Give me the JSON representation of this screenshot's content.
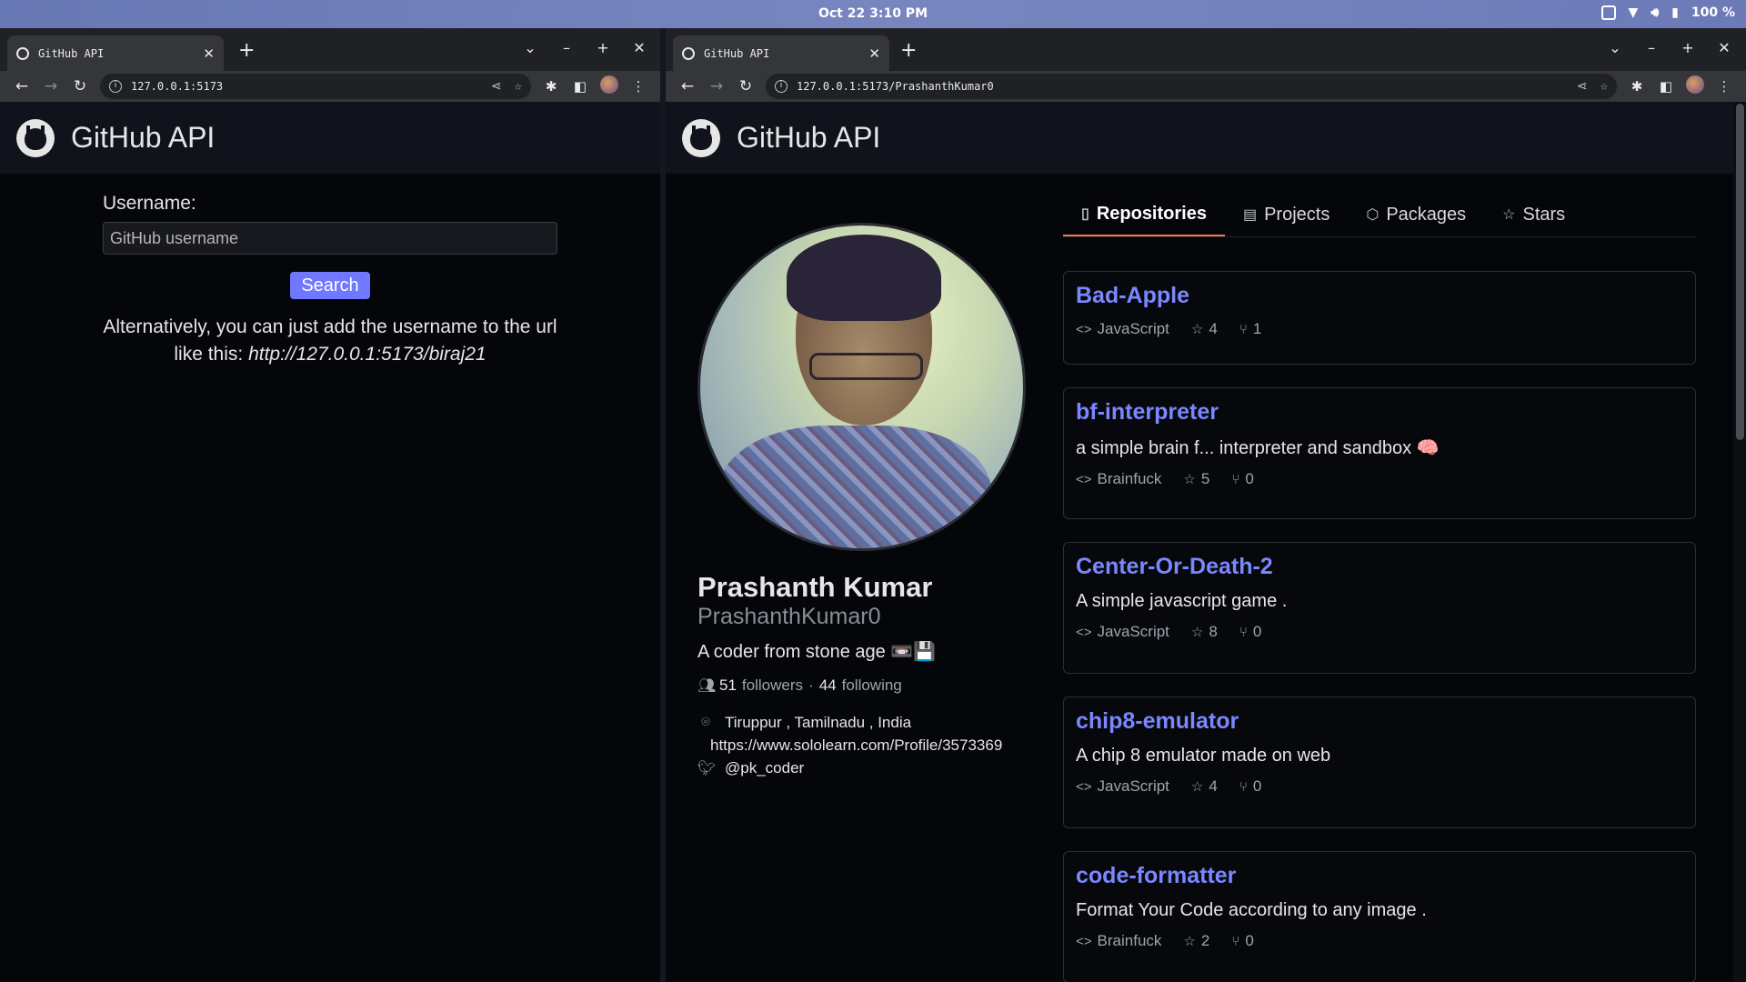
{
  "system_bar": {
    "clock": "Oct 22   3:10 PM",
    "battery": "100 %"
  },
  "left_window": {
    "tab_title": "GitHub API",
    "url": "127.0.0.1:5173",
    "app_title": "GitHub API",
    "search": {
      "label": "Username:",
      "placeholder": "GitHub username",
      "button": "Search",
      "hint_text": "Alternatively, you can just add the username to the url like this:",
      "hint_url": "http://127.0.0.1:5173/biraj21"
    }
  },
  "right_window": {
    "tab_title": "GitHub API",
    "url": "127.0.0.1:5173/PrashanthKumar0",
    "app_title": "GitHub API",
    "profile": {
      "name": "Prashanth Kumar",
      "login": "PrashanthKumar0",
      "bio": "A coder from stone age 📼💾",
      "followers_count": "51",
      "followers_label": "followers",
      "separator": "·",
      "following_count": "44",
      "following_label": "following",
      "location": "Tiruppur , Tamilnadu , India",
      "website": "https://www.sololearn.com/Profile/3573369",
      "twitter": "@pk_coder"
    },
    "tabs": [
      {
        "label": "Repositories",
        "icon": "book-icon"
      },
      {
        "label": "Projects",
        "icon": "table-icon"
      },
      {
        "label": "Packages",
        "icon": "package-icon"
      },
      {
        "label": "Stars",
        "icon": "star-icon"
      }
    ],
    "repos": [
      {
        "name": "Bad-Apple",
        "description": "",
        "language": "JavaScript",
        "stars": "4",
        "forks": "1"
      },
      {
        "name": "bf-interpreter",
        "description": "a simple brain f... interpreter and sandbox 🧠",
        "language": "Brainfuck",
        "stars": "5",
        "forks": "0"
      },
      {
        "name": "Center-Or-Death-2",
        "description": "A simple javascript game .",
        "language": "JavaScript",
        "stars": "8",
        "forks": "0"
      },
      {
        "name": "chip8-emulator",
        "description": "A chip 8 emulator made on web",
        "language": "JavaScript",
        "stars": "4",
        "forks": "0"
      },
      {
        "name": "code-formatter",
        "description": "Format Your Code according to any image .",
        "language": "Brainfuck",
        "stars": "2",
        "forks": "0"
      }
    ]
  },
  "colors": {
    "accent": "#6f78ff",
    "link": "#7a87ff",
    "tab_underline": "#f07850",
    "header_bg": "#11131c"
  }
}
